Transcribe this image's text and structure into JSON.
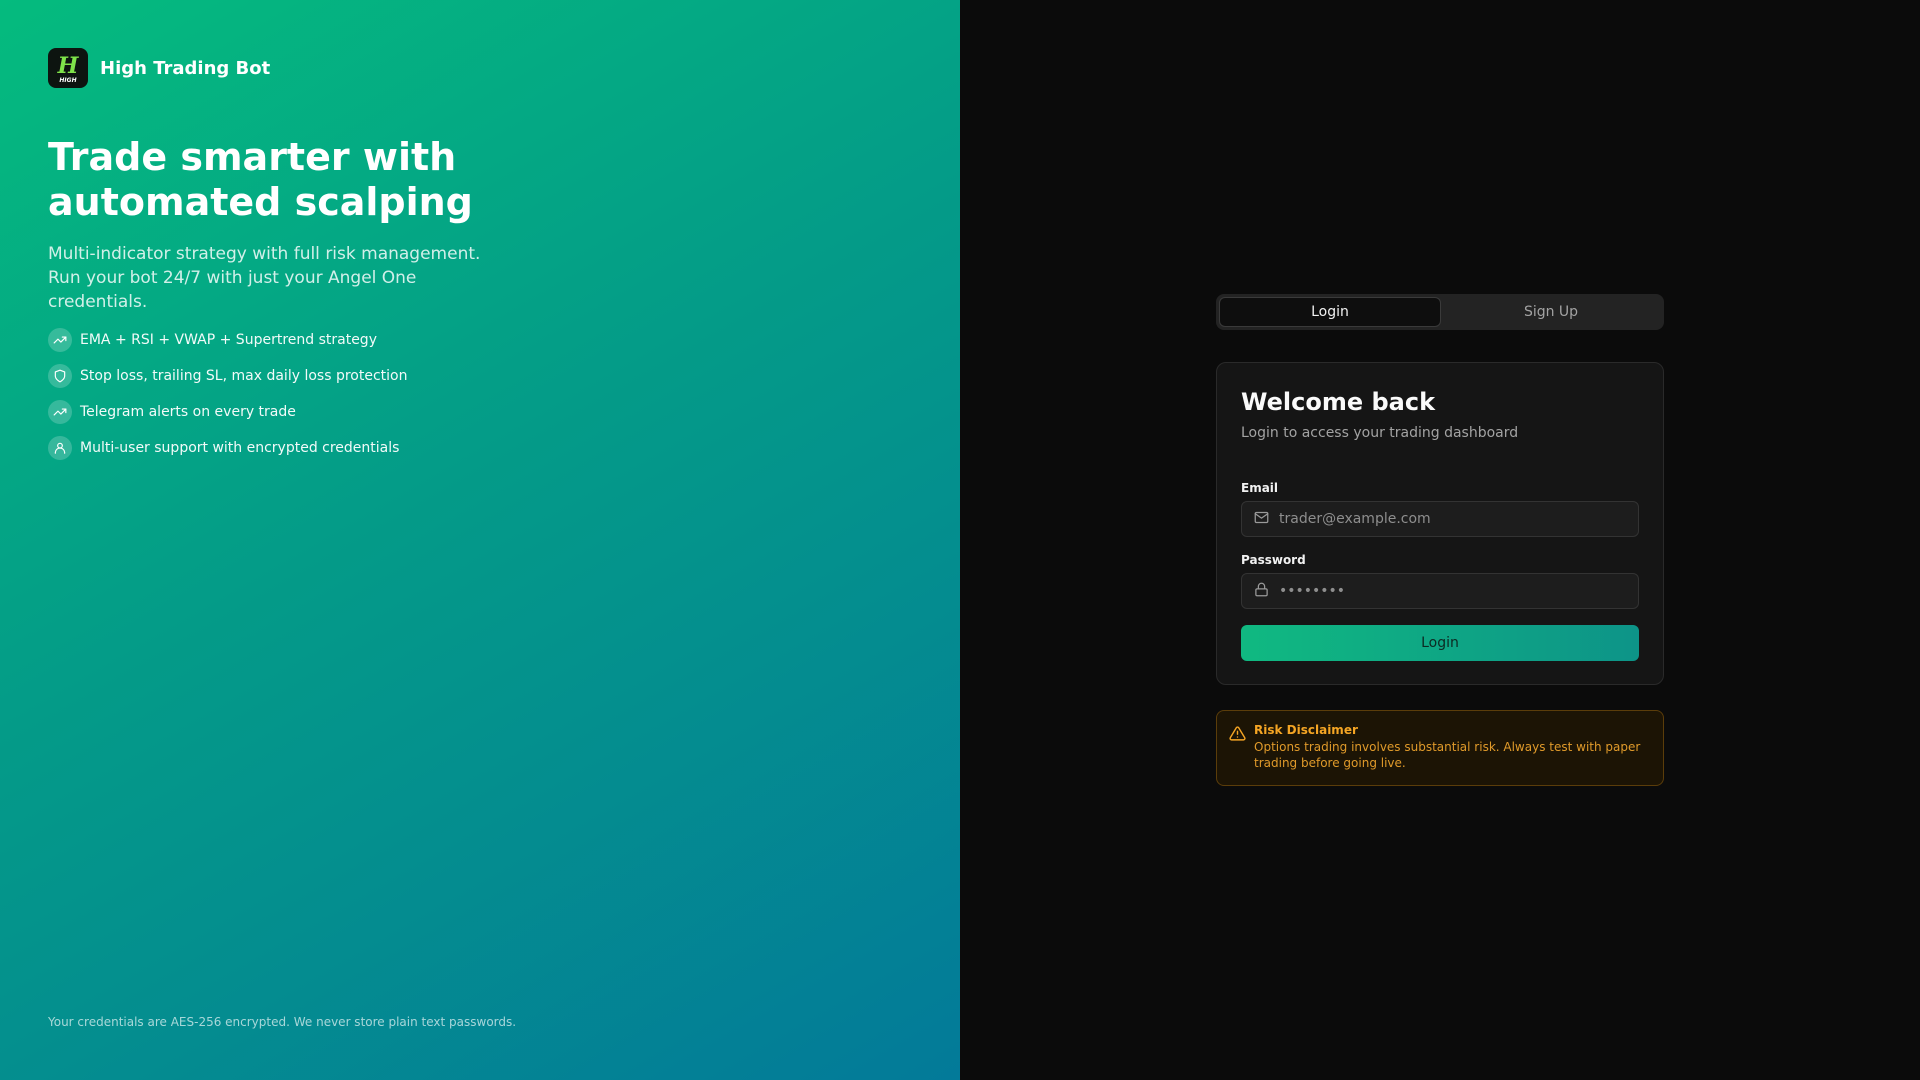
{
  "brand": {
    "name": "High Trading Bot",
    "logo_mark": "H",
    "logo_sub": "HIGH"
  },
  "hero": {
    "headline": "Trade smarter with automated scalping",
    "subline": "Multi-indicator strategy with full risk management. Run your bot 24/7 with just your Angel One credentials."
  },
  "features": [
    {
      "icon": "trending-up-icon",
      "text": "EMA + RSI + VWAP + Supertrend strategy"
    },
    {
      "icon": "shield-icon",
      "text": "Stop loss, trailing SL, max daily loss protection"
    },
    {
      "icon": "trending-up-icon",
      "text": "Telegram alerts on every trade"
    },
    {
      "icon": "user-icon",
      "text": "Multi-user support with encrypted credentials"
    }
  ],
  "footnote": "Your credentials are AES-256 encrypted. We never store plain text passwords.",
  "auth": {
    "tabs": [
      {
        "label": "Login",
        "active": true
      },
      {
        "label": "Sign Up",
        "active": false
      }
    ],
    "title": "Welcome back",
    "subtitle": "Login to access your trading dashboard",
    "email_label": "Email",
    "email_placeholder": "trader@example.com",
    "password_label": "Password",
    "password_placeholder": "••••••••",
    "submit_label": "Login"
  },
  "disclaimer": {
    "title": "Risk Disclaimer",
    "text": "Options trading involves substantial risk. Always test with paper trading before going live."
  },
  "colors": {
    "accent": "#10b981",
    "accent_end": "#0d9488",
    "warning": "#f5a524",
    "panel_bg": "#0b0b0b"
  }
}
